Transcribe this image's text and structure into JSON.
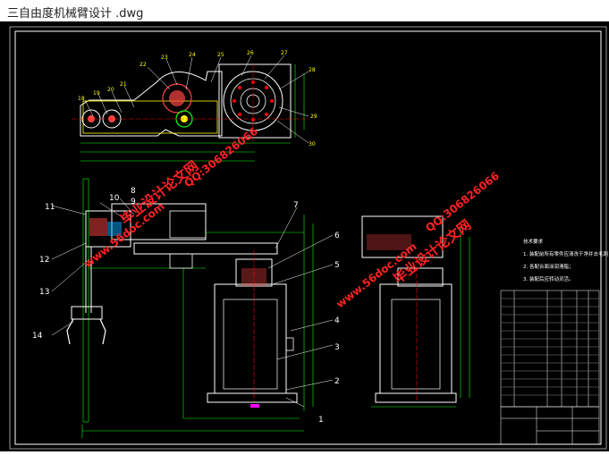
{
  "window": {
    "title": "三自由度机械臂设计 .dwg"
  },
  "drawing": {
    "top_view_balloons": [
      "18",
      "19",
      "20",
      "21",
      "22",
      "23",
      "24",
      "25",
      "26",
      "27",
      "28",
      "29",
      "30"
    ],
    "front_view_balloons": [
      "1",
      "2",
      "3",
      "4",
      "5",
      "6",
      "7",
      "8",
      "9",
      "10",
      "11",
      "12",
      "13",
      "14"
    ],
    "watermarks": [
      "毕业设计论文网",
      "www.56doc.com",
      "QQ:306826066",
      "毕业设计论文网",
      "www.56doc.com",
      "QQ:306826066"
    ],
    "technical_requirements": [
      "技术要求",
      "1. 装配前所有零件应清洗干净并去毛刺；",
      "2. 各配合面涂润滑脂；",
      "3. 装配后应转动灵活。"
    ],
    "colors": {
      "background": "#000000",
      "white": "#ffffff",
      "yellow": "#ffff00",
      "green": "#00ff00",
      "red": "#ff0000",
      "cyan": "#00ffff",
      "magenta": "#ff00ff",
      "watermark": "#ff2222"
    }
  }
}
